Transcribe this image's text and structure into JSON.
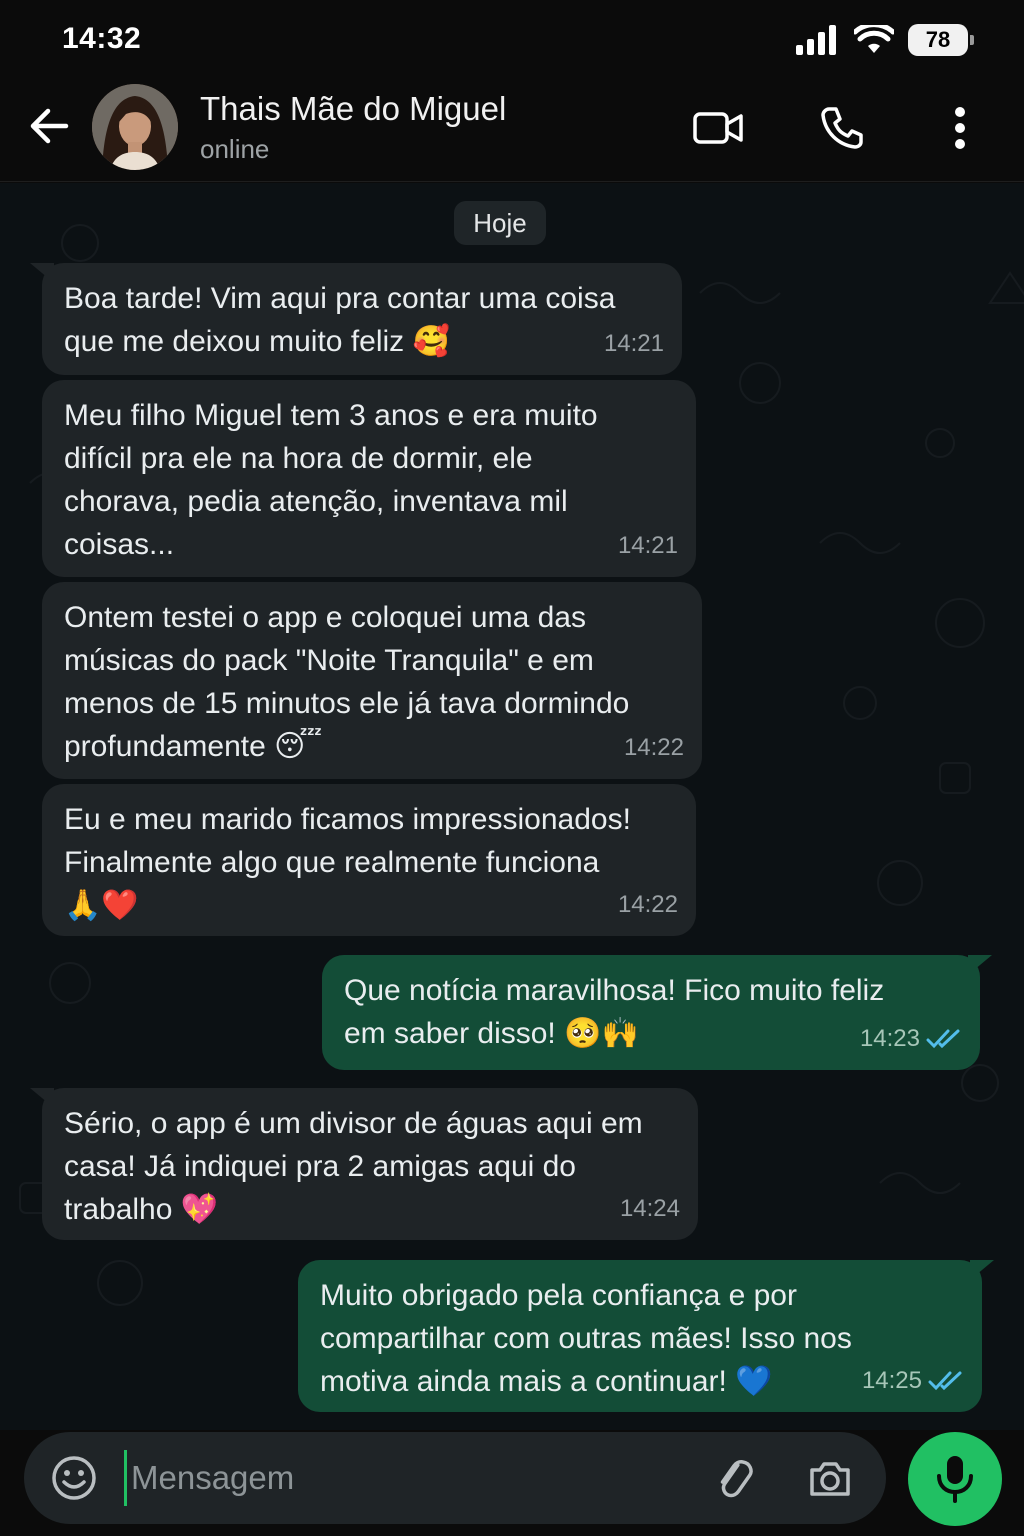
{
  "status_bar": {
    "time": "14:32",
    "battery": "78"
  },
  "header": {
    "contact_name": "Thais Mãe do Miguel",
    "contact_status": "online"
  },
  "chat": {
    "date_label": "Hoje",
    "messages": [
      {
        "direction": "in",
        "text": "Boa tarde! Vim aqui pra contar uma coisa\nque me deixou muito feliz 🥰",
        "time": "14:21"
      },
      {
        "direction": "in",
        "text": "Meu filho Miguel tem 3 anos e era muito\ndifícil pra ele na hora de dormir, ele\nchorava, pedia atenção, inventava mil\ncoisas...",
        "time": "14:21"
      },
      {
        "direction": "in",
        "text": "Ontem testei o app e coloquei uma das\nmúsicas do pack \"Noite Tranquila\" e em\nmenos de 15 minutos ele já tava dormindo\nprofundamente 😴",
        "time": "14:22"
      },
      {
        "direction": "in",
        "text": "Eu e meu marido ficamos impressionados!\nFinalmente algo que realmente funciona\n🙏❤️",
        "time": "14:22"
      },
      {
        "direction": "out",
        "text": "Que notícia maravilhosa! Fico muito feliz\nem saber disso! 🥺🙌",
        "time": "14:23",
        "status": "read"
      },
      {
        "direction": "in",
        "text": "Sério, o app é um divisor de águas aqui em\ncasa! Já indiquei pra 2 amigas aqui do\ntrabalho 💖",
        "time": "14:24"
      },
      {
        "direction": "out",
        "text": "Muito obrigado pela confiança e por\ncompartilhar com outras mães! Isso nos\nmotiva ainda mais a continuar! 💙",
        "time": "14:25",
        "status": "read"
      }
    ]
  },
  "composer": {
    "placeholder": "Mensagem"
  },
  "colors": {
    "incoming_bubble": "#1f2427",
    "outgoing_bubble": "#134d37",
    "accent": "#21c063",
    "read_ticks": "#53bdeb"
  },
  "icons": [
    "back-arrow-icon",
    "video-call-icon",
    "phone-icon",
    "more-options-icon",
    "emoji-icon",
    "attach-icon",
    "camera-icon",
    "mic-icon",
    "signal-icon",
    "wifi-icon",
    "read-ticks-icon"
  ]
}
